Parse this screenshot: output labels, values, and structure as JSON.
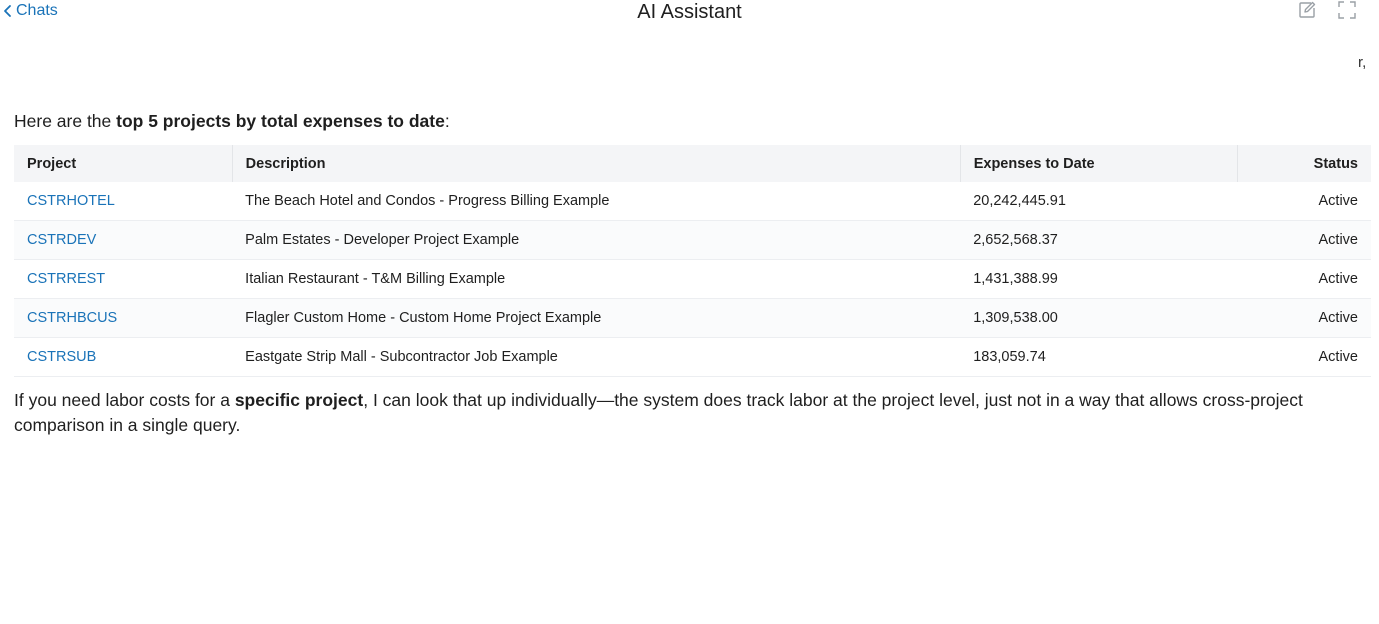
{
  "header": {
    "back_label": "Chats",
    "title": "AI Assistant",
    "icons": [
      "chevron-left-icon",
      "edit-icon",
      "expand-icon"
    ]
  },
  "stray_text": "r,",
  "message": {
    "intro_prefix": "Here are the ",
    "intro_bold": "top 5 projects by total expenses to date",
    "intro_suffix": ":",
    "table": {
      "headers": [
        "Project",
        "Description",
        "Expenses to Date",
        "Status"
      ],
      "rows": [
        {
          "project": "CSTRHOTEL",
          "description": "The Beach Hotel and Condos - Progress Billing Example",
          "expenses": "20,242,445.91",
          "status": "Active"
        },
        {
          "project": "CSTRDEV",
          "description": "Palm Estates - Developer Project Example",
          "expenses": "2,652,568.37",
          "status": "Active"
        },
        {
          "project": "CSTRREST",
          "description": "Italian Restaurant - T&M Billing Example",
          "expenses": "1,431,388.99",
          "status": "Active"
        },
        {
          "project": "CSTRHBCUS",
          "description": "Flagler Custom Home - Custom Home Project Example",
          "expenses": "1,309,538.00",
          "status": "Active"
        },
        {
          "project": "CSTRSUB",
          "description": "Eastgate Strip Mall - Subcontractor Job Example",
          "expenses": "183,059.74",
          "status": "Active"
        }
      ]
    },
    "outro_prefix": "If you need labor costs for a ",
    "outro_bold": "specific project",
    "outro_suffix": ", I can look that up individually—the system does track labor at the project level, just not in a way that allows cross-project comparison in a single query."
  },
  "colors": {
    "link": "#1a73b8",
    "header_bg": "#f4f5f7",
    "text": "#1f1f1f"
  }
}
